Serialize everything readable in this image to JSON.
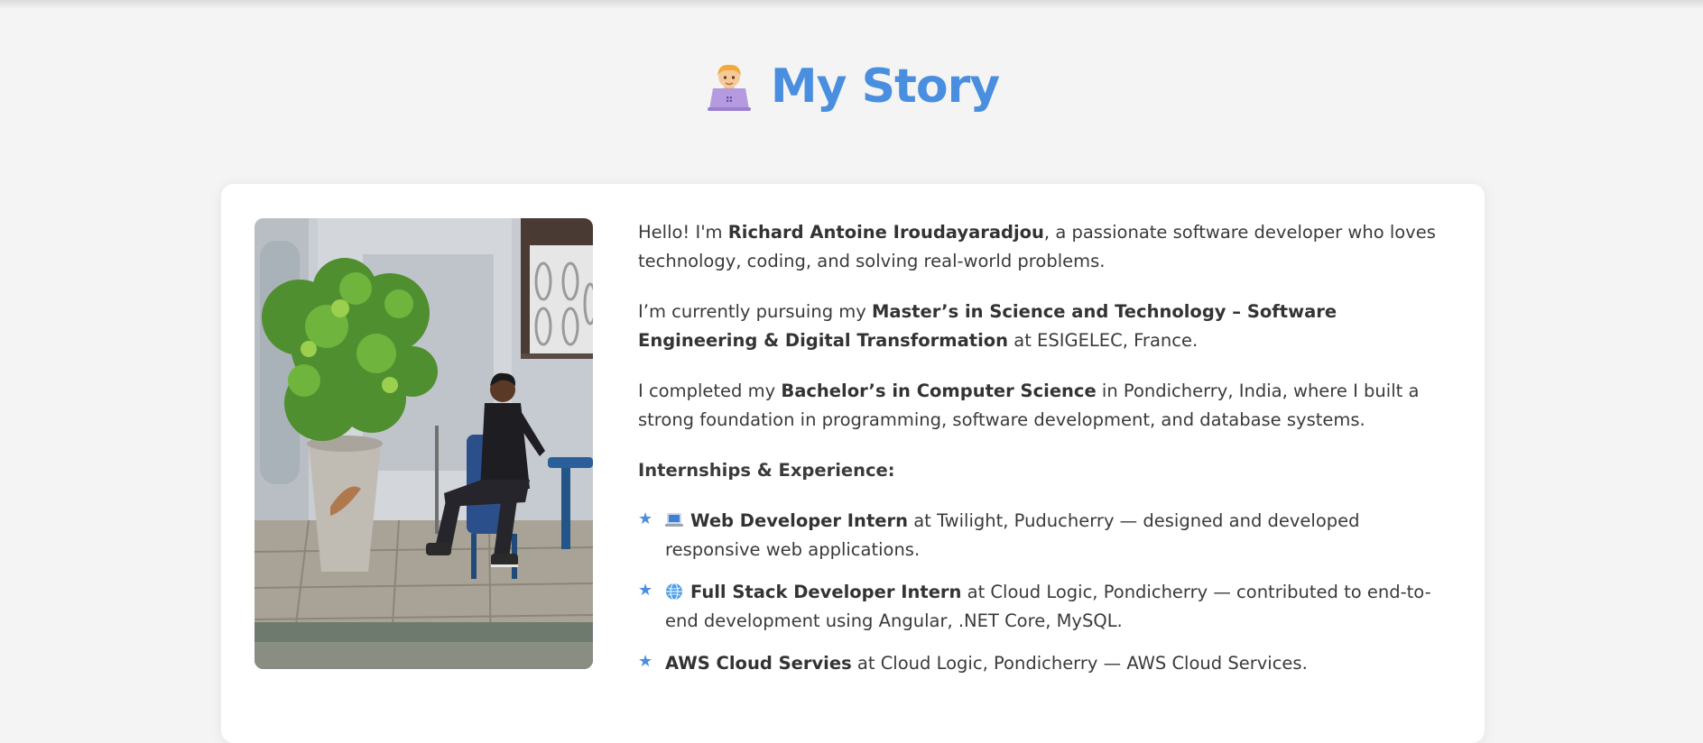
{
  "header": {
    "title": "My Story",
    "title_icon": "technologist-emoji-icon",
    "accent_color": "#4a8fdf"
  },
  "profile_photo": {
    "alt": "Richard Antoine Iroudayaradjou"
  },
  "about": {
    "intro": {
      "before": "Hello! I'm ",
      "name": "Richard Antoine Iroudayaradjou",
      "after": ", a passionate software developer who loves technology, coding, and solving real-world problems."
    },
    "masters": {
      "before": "I’m currently pursuing my ",
      "degree": "Master’s in Science and Technology – Software Engineering & Digital Transformation",
      "after": " at ESIGELEC, France."
    },
    "bachelors": {
      "before": "I completed my ",
      "degree": "Bachelor’s in Computer Science",
      "after": " in Pondicherry, India, where I built a strong foundation in programming, software development, and database systems."
    },
    "experience_heading": "Internships & Experience:",
    "experience": [
      {
        "icon": "laptop-icon",
        "role": "Web Developer Intern",
        "details": " at Twilight, Puducherry — designed and developed responsive web applications."
      },
      {
        "icon": "globe-icon",
        "role": "Full Stack Developer Intern",
        "details": " at Cloud Logic, Pondicherry — contributed to end-to-end development using Angular, .NET Core, MySQL."
      },
      {
        "icon": "",
        "role": "AWS Cloud Servies",
        "details": " at Cloud Logic, Pondicherry — AWS Cloud Services."
      }
    ]
  }
}
